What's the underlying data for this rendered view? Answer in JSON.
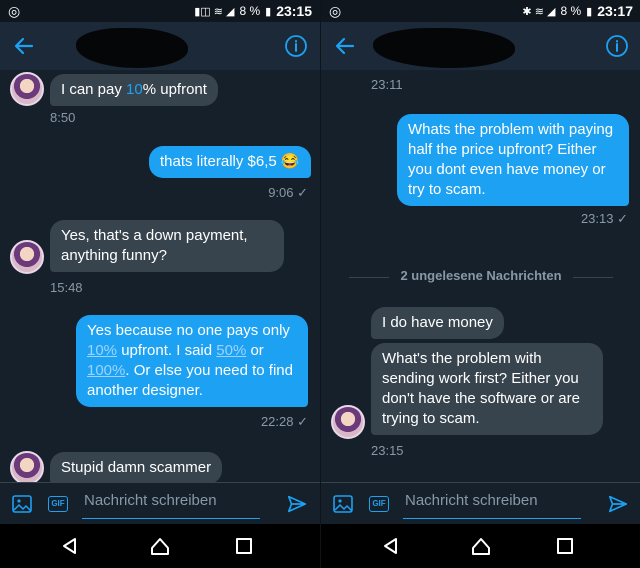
{
  "left": {
    "statusbar": {
      "battery": "8 %",
      "time": "23:15"
    },
    "messages": [
      {
        "pre": "I can pay ",
        "link": "10",
        "post": "% upfront"
      },
      {
        "text": "thats literally $6,5 😂"
      },
      {
        "text": "Yes, that's a down payment, anything funny?"
      },
      {
        "p1": "Yes because no one pays only ",
        "l1": "10%",
        "p2": " upfront. I said ",
        "l2": "50%",
        "p3": " or ",
        "l3": "100%",
        "p4": ". Or else you need to find another designer."
      },
      {
        "text": "Stupid damn scammer"
      }
    ],
    "timestamps": {
      "t1": "8:50",
      "t2": "9:06 ✓",
      "t3": "15:48",
      "t4": "22:28 ✓"
    }
  },
  "right": {
    "statusbar": {
      "battery": "8 %",
      "time": "23:17"
    },
    "messages": [
      {
        "text": "Whats the problem with paying half the price upfront? Either you dont even have money or try to scam."
      },
      {
        "text": "I do have money"
      },
      {
        "text": "What's the problem with sending work first? Either you don't have the software or are trying to scam."
      }
    ],
    "timestamps": {
      "t0": "23:11",
      "t1": "23:13 ✓",
      "t2": "23:15"
    },
    "divider": "2 ungelesene Nachrichten"
  },
  "composer": {
    "placeholder": "Nachricht schreiben",
    "gif_label": "GIF"
  },
  "icons": [
    "back-arrow-icon",
    "info-icon",
    "image-icon",
    "gif-icon",
    "send-icon",
    "nav-back-icon",
    "nav-home-icon",
    "nav-recent-icon"
  ],
  "colors": {
    "background": "#15202b",
    "outgoing": "#1da1f2",
    "incoming": "#38444d",
    "muted": "#8899a6"
  }
}
